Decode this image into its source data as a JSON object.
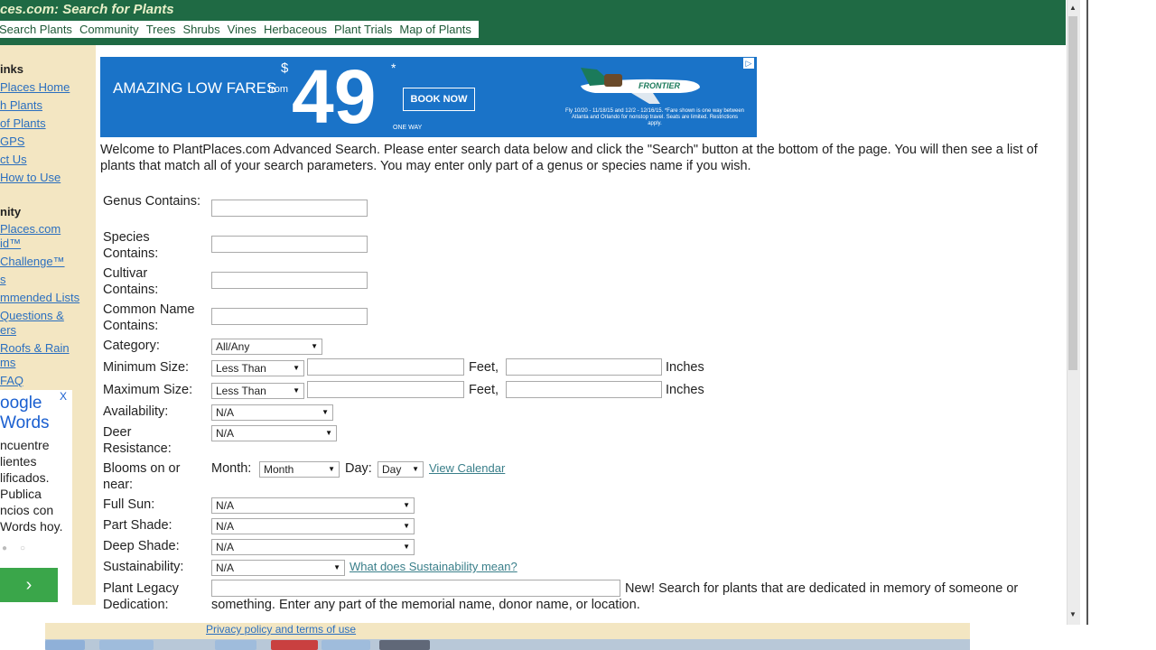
{
  "header": {
    "site_title": "ces.com: Search for Plants",
    "nav": [
      "Search Plants",
      "Community",
      "Trees",
      "Shrubs",
      "Vines",
      "Herbaceous",
      "Plant Trials",
      "Map of Plants"
    ]
  },
  "sidebar": {
    "links_heading": "inks",
    "links": [
      "Places Home",
      "h Plants",
      "of Plants",
      "GPS",
      "ct Us",
      "How to Use"
    ],
    "community_heading": "nity",
    "community_links": [
      "Places.com",
      "id™",
      "Challenge™",
      "s",
      "mmended Lists",
      "Questions &",
      "ers",
      "Roofs & Rain",
      "ms",
      "FAQ"
    ],
    "ad": {
      "logo_line1": "oogle",
      "logo_line2": "Words",
      "close": "X",
      "text": "ncuentre\nlientes\nlificados.\nPublica\nncios con\nWords hoy.",
      "button": "›"
    }
  },
  "banner": {
    "headline": "AMAZING LOW FARES",
    "from": "from",
    "currency": "$",
    "price": "49",
    "asterisk": "*",
    "one_way": "ONE WAY",
    "cta": "BOOK NOW",
    "airline": "FRONTIER",
    "fine_print": "Fly 10/20 - 11/18/15 and 12/2 - 12/16/15. *Fare shown is one way between Atlanta and Orlando for nonstop travel. Seats are limited. Restrictions apply."
  },
  "welcome": "Welcome to PlantPlaces.com Advanced Search. Please enter search data below and click the \"Search\" button at the bottom of the page. You will then see a list of plants that match all of your search parameters. You may enter only part of a genus or species name if you wish.",
  "form": {
    "genus": "Genus Contains:",
    "species": "Species Contains:",
    "cultivar": "Cultivar Contains:",
    "common_name": "Common Name Contains:",
    "category": "Category:",
    "category_value": "All/Any",
    "min_size": "Minimum Size:",
    "max_size": "Maximum Size:",
    "size_op": "Less Than",
    "feet": "Feet,",
    "inches": "Inches",
    "availability": "Availability:",
    "deer": "Deer Resistance:",
    "blooms": "Blooms on or near:",
    "month_label": "Month:",
    "month_value": "Month",
    "day_label": "Day:",
    "day_value": "Day",
    "view_calendar": "View Calendar",
    "full_sun": "Full Sun:",
    "part_shade": "Part Shade:",
    "deep_shade": "Deep Shade:",
    "sustainability": "Sustainability:",
    "sustainability_link": "What does Sustainability mean?",
    "legacy": "Plant Legacy Dedication:",
    "legacy_note": "New! Search for plants that are dedicated in memory of someone or something. Enter any part of the memorial name, donor name, or location.",
    "na": "N/A"
  },
  "status_link": "Privacy policy and terms of use",
  "colors": {
    "header_green": "#1f6a44",
    "sidebar_tan": "#f3e6c2",
    "banner_blue": "#1a73c8"
  }
}
